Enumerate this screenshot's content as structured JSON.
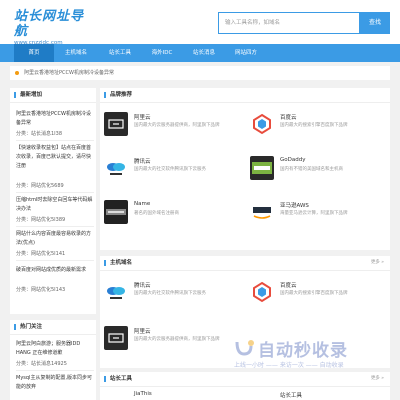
{
  "header": {
    "logo_main": "站长网址导航",
    "logo_sub": "www.cnzzidc.com",
    "search_placeholder": "输入工具名称，如域名",
    "search_button": "查找"
  },
  "nav": {
    "items": [
      "首页",
      "主机域名",
      "站长工具",
      "海外IDC",
      "站长消息",
      "网站四方"
    ]
  },
  "notice": "阿里云香港地址PCCW机房制冷设备异常",
  "latest": {
    "title": "最新增加",
    "items": [
      {
        "title": "阿里云香港地址PCCW机房制冷设备异常",
        "meta": "分类：站长消息1I38"
      },
      {
        "title": "【快速收录权益包】站点在百度首次收录，百度已默认提交，请尽快注册",
        "meta": "分类：网站优化5689"
      },
      {
        "title": "压缩html时去除空白回车等代码解决办法",
        "meta": "分类：网站优化5I389"
      },
      {
        "title": "网站什么内容百度最容易收录的方法(优点)",
        "meta": "分类：网站优化5I141"
      },
      {
        "title": "破百度对网站成优质的最新需求",
        "meta": "分类：网站优化5I143"
      }
    ]
  },
  "hot": {
    "title": "热门关注",
    "items": [
      {
        "title": "阿里云阿白旅游；服务器IDD HANG 正在维修道歉",
        "meta": "分类：站长消息14925"
      },
      {
        "title": "Mysql主从复制的配置,版本同步可能的放弃",
        "meta": ""
      }
    ]
  },
  "recommend": {
    "title": "品牌推荐",
    "sites": [
      {
        "name": "阿里云",
        "desc": "国内最大的云服务器提供商，阿里旗下品牌",
        "logo": "aliyun-logo"
      },
      {
        "name": "百度云",
        "desc": "国内最大的搜索引擎百度旗下品牌",
        "logo": "baidu-cloud-logo"
      },
      {
        "name": "腾讯云",
        "desc": "国内最大的社交软件腾讯旗下云服务",
        "logo": "tencent-cloud-logo"
      },
      {
        "name": "GoDaddy",
        "desc": "国内有不错的美国域名和主机商",
        "logo": "godaddy-logo"
      },
      {
        "name": "Name",
        "desc": "著名的国外域名注册商",
        "logo": "name-com-logo"
      },
      {
        "name": "亚马逊AWS",
        "desc": "海量亚马逊云计算，阿里旗下品牌",
        "logo": "aws-logo"
      }
    ]
  },
  "hosting": {
    "title": "主机域名",
    "more": "更多 »",
    "sites": [
      {
        "name": "腾讯云",
        "desc": "国内最大的社交软件腾讯旗下云服务",
        "logo": "tencent-cloud-logo"
      },
      {
        "name": "百度云",
        "desc": "国内最大的搜索引擎百度旗下品牌",
        "logo": "baidu-cloud-logo"
      },
      {
        "name": "阿里云",
        "desc": "国内最大的云服务器提供商，阿里旗下品牌",
        "logo": "aliyun-logo"
      }
    ]
  },
  "tools": {
    "title": "站长工具",
    "more": "更多 »",
    "sites": [
      {
        "name": "JiaThis",
        "desc": "",
        "logo": ""
      },
      {
        "name": "站长工具",
        "desc": "",
        "logo": ""
      }
    ]
  },
  "watermark": {
    "main": "自动秒收录",
    "sub": "上线一小时 —— 来访一次 —— 自动收录"
  },
  "colors": {
    "accent": "#3b9be5",
    "nav_active": "#1f7cc6",
    "notice_dot": "#f39c12"
  }
}
